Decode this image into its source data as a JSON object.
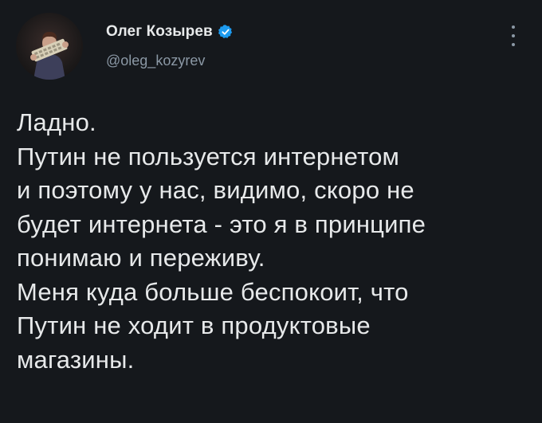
{
  "author": {
    "display_name": "Олег Козырев",
    "handle": "@oleg_kozyrev",
    "verified": true,
    "avatar": "profile-photo"
  },
  "colors": {
    "background": "#15181c",
    "text": "#e7e9ea",
    "secondary": "#8b98a5",
    "verified_badge": "#1d9bf0"
  },
  "menu": {
    "icon": "more-vertical-icon"
  },
  "tweet": {
    "lines": [
      "Ладно.",
      "Путин не пользуется интернетом",
      "и поэтому у нас, видимо, скоро не",
      "будет интернета - это я в принципе",
      "понимаю и переживу.",
      "Меня куда больше беспокоит, что",
      "Путин не ходит в продуктовые",
      "магазины."
    ]
  }
}
